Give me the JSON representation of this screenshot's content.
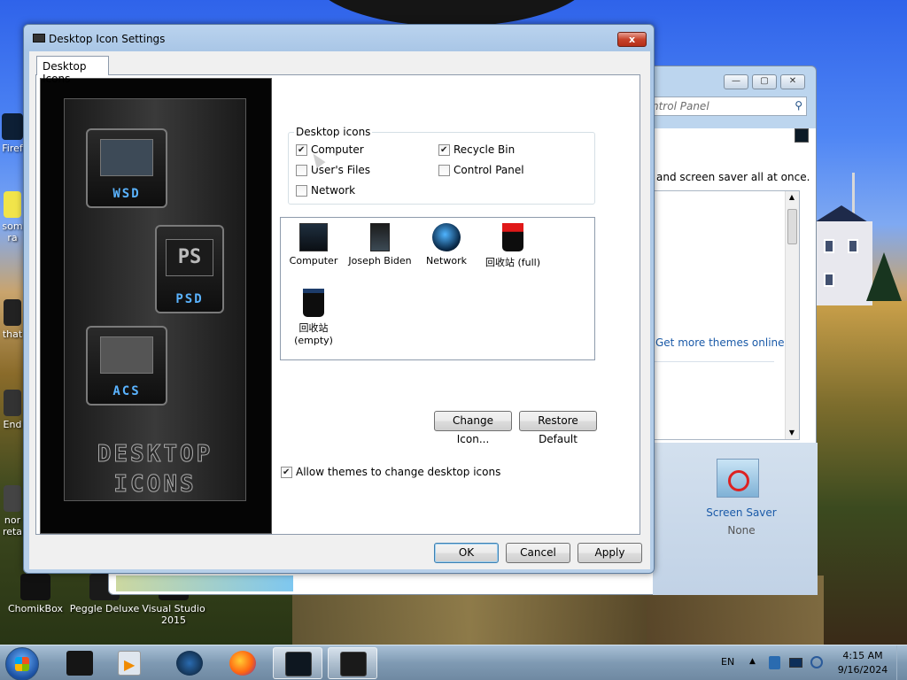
{
  "desktop": {
    "icons": [
      {
        "label": "Firef",
        "icon": "firefox-shortcut-icon"
      },
      {
        "label": "som",
        "icon": "file-icon"
      },
      {
        "label": "ra",
        "icon": "file-icon"
      },
      {
        "label": "that",
        "icon": "file-icon"
      },
      {
        "label": "End",
        "icon": "file-icon"
      },
      {
        "label": "nor",
        "icon": "file-icon"
      },
      {
        "label": "reta",
        "icon": "file-icon"
      },
      {
        "label": "ChomikBox",
        "icon": "chomikbox-icon"
      },
      {
        "label": "Peggle Deluxe",
        "icon": "peggle-icon"
      },
      {
        "label": "Visual Studio 2015",
        "icon": "visual-studio-icon"
      }
    ]
  },
  "back_window": {
    "address_placeholder": "ntrol Panel",
    "text_line": "and screen saver all at once.",
    "link": "Get more themes online",
    "screen_saver": {
      "label": "Screen Saver",
      "value": "None"
    }
  },
  "dialog": {
    "title": "Desktop Icon Settings",
    "close_label": "x",
    "tab": "Desktop Icons",
    "preview": {
      "tiles": [
        {
          "label": "WSD"
        },
        {
          "label": "PSD",
          "top": "PS"
        },
        {
          "label": "ACS"
        }
      ],
      "caption_line1": "DESKTOP",
      "caption_line2": "ICONS"
    },
    "group_label": "Desktop icons",
    "checkboxes": [
      {
        "label": "Computer",
        "checked": true
      },
      {
        "label": "User's Files",
        "checked": false
      },
      {
        "label": "Network",
        "checked": false
      },
      {
        "label": "Recycle Bin",
        "checked": true
      },
      {
        "label": "Control Panel",
        "checked": false
      }
    ],
    "icons": [
      {
        "label": "Computer",
        "icon": "computer-monitor-icon"
      },
      {
        "label": "Joseph Biden",
        "icon": "user-files-icon"
      },
      {
        "label": "Network",
        "icon": "network-globe-icon"
      },
      {
        "label": "回收站 (full)",
        "icon": "recycle-bin-full-icon"
      },
      {
        "label": "回收站\n(empty)",
        "icon": "recycle-bin-empty-icon"
      }
    ],
    "change_icon": "Change Icon...",
    "restore_default": "Restore Default",
    "allow_themes": "Allow themes to change desktop icons",
    "allow_themes_checked": true,
    "ok": "OK",
    "cancel": "Cancel",
    "apply": "Apply"
  },
  "taskbar": {
    "language": "EN",
    "time": "4:15 AM",
    "date": "9/16/2024"
  }
}
